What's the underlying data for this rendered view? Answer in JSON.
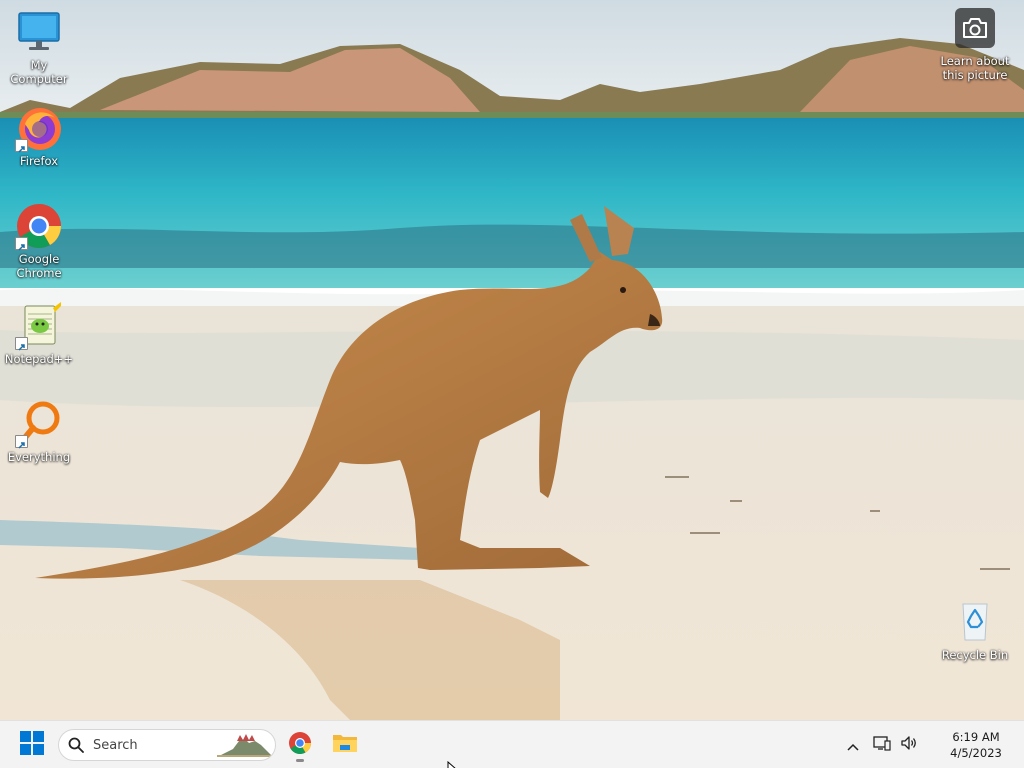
{
  "desktop": {
    "icons": [
      {
        "label": "My Computer",
        "icon": "monitor-icon"
      },
      {
        "label": "Firefox",
        "icon": "firefox-icon"
      },
      {
        "label": "Google Chrome",
        "icon": "chrome-icon"
      },
      {
        "label": "Notepad++",
        "icon": "notepadpp-icon"
      },
      {
        "label": "Everything",
        "icon": "everything-search-icon"
      },
      {
        "label": "Recycle Bin",
        "icon": "recycle-bin-icon"
      }
    ],
    "spotlight": {
      "label": "Learn about this picture",
      "icon": "camera-icon"
    }
  },
  "taskbar": {
    "search_placeholder": "Search",
    "pinned": [
      {
        "name": "Google Chrome",
        "icon": "chrome-icon"
      },
      {
        "name": "File Explorer",
        "icon": "folder-icon"
      }
    ],
    "tray": {
      "time": "6:19 AM",
      "date": "4/5/2023"
    }
  },
  "colors": {
    "taskbar_bg": "#f3f3f3",
    "start_blue": "#0078d4"
  }
}
